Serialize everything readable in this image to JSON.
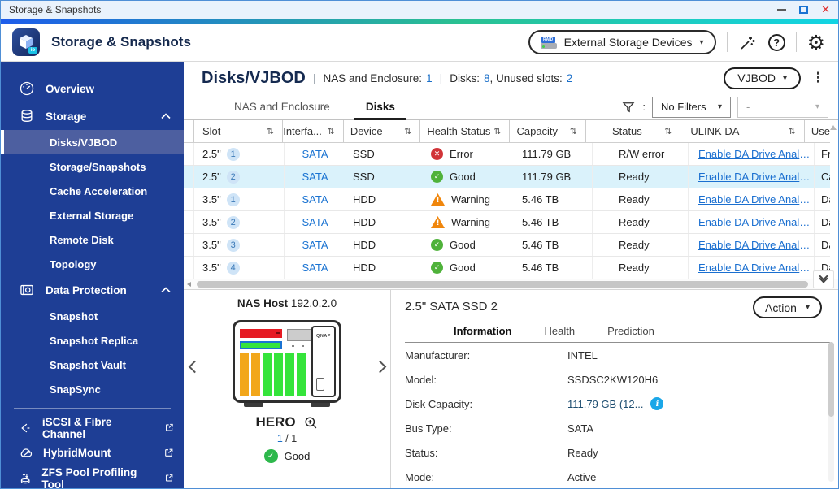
{
  "window": {
    "title": "Storage & Snapshots"
  },
  "app_header": {
    "title": "Storage & Snapshots",
    "logo_badge": "io",
    "external_storage_button": "External Storage Devices"
  },
  "sidebar": {
    "overview": {
      "label": "Overview"
    },
    "storage": {
      "label": "Storage",
      "children": [
        {
          "label": "Disks/VJBOD",
          "selected": true
        },
        {
          "label": "Storage/Snapshots",
          "selected": false
        },
        {
          "label": "Cache Acceleration",
          "selected": false
        },
        {
          "label": "External Storage",
          "selected": false
        },
        {
          "label": "Remote Disk",
          "selected": false
        },
        {
          "label": "Topology",
          "selected": false
        }
      ]
    },
    "data_protection": {
      "label": "Data Protection",
      "children": [
        {
          "label": "Snapshot"
        },
        {
          "label": "Snapshot Replica"
        },
        {
          "label": "Snapshot Vault"
        },
        {
          "label": "SnapSync"
        }
      ]
    },
    "links": [
      {
        "label": "iSCSI & Fibre Channel"
      },
      {
        "label": "HybridMount"
      },
      {
        "label": "ZFS Pool Profiling Tool"
      }
    ]
  },
  "page": {
    "title": "Disks/VJBOD",
    "summary": {
      "p1": "NAS and Enclosure:",
      "v1": "1",
      "p2": "Disks:",
      "v2": "8",
      "p3": ", Unused slots:",
      "v3": "2"
    },
    "vjbod_button": "VJBOD"
  },
  "tabs": [
    {
      "label": "NAS and Enclosure",
      "active": false
    },
    {
      "label": "Disks",
      "active": true
    }
  ],
  "filters": {
    "primary": "No Filters",
    "secondary": "-"
  },
  "table": {
    "columns": [
      "Slot",
      "Interfa...",
      "Device",
      "Health Status",
      "Capacity",
      "Status",
      "ULINK DA",
      "Use"
    ],
    "rows": [
      {
        "slot": "2.5\"",
        "slot_num": "1",
        "interface": "SATA",
        "device": "SSD",
        "health": "Error",
        "health_type": "error",
        "capacity": "111.79 GB",
        "status": "R/W error",
        "ulink": "Enable DA Drive Analy...",
        "use": "Free",
        "selected": false
      },
      {
        "slot": "2.5\"",
        "slot_num": "2",
        "interface": "SATA",
        "device": "SSD",
        "health": "Good",
        "health_type": "good",
        "capacity": "111.79 GB",
        "status": "Ready",
        "ulink": "Enable DA Drive Analy...",
        "use": "Cache",
        "selected": true
      },
      {
        "slot": "3.5\"",
        "slot_num": "1",
        "interface": "SATA",
        "device": "HDD",
        "health": "Warning",
        "health_type": "warning",
        "capacity": "5.46 TB",
        "status": "Ready",
        "ulink": "Enable DA Drive Analy...",
        "use": "Data",
        "selected": false
      },
      {
        "slot": "3.5\"",
        "slot_num": "2",
        "interface": "SATA",
        "device": "HDD",
        "health": "Warning",
        "health_type": "warning",
        "capacity": "5.46 TB",
        "status": "Ready",
        "ulink": "Enable DA Drive Analy...",
        "use": "Data",
        "selected": false
      },
      {
        "slot": "3.5\"",
        "slot_num": "3",
        "interface": "SATA",
        "device": "HDD",
        "health": "Good",
        "health_type": "good",
        "capacity": "5.46 TB",
        "status": "Ready",
        "ulink": "Enable DA Drive Analy...",
        "use": "Data",
        "selected": false
      },
      {
        "slot": "3.5\"",
        "slot_num": "4",
        "interface": "SATA",
        "device": "HDD",
        "health": "Good",
        "health_type": "good",
        "capacity": "5.46 TB",
        "status": "Ready",
        "ulink": "Enable DA Drive Analy...",
        "use": "Data",
        "selected": false
      }
    ]
  },
  "nas_panel": {
    "host_label": "NAS Host",
    "host_ip": "192.0.2.0",
    "brand": "QNAP",
    "name": "HERO",
    "page_current": "1",
    "page_rest": "/ 1",
    "status": "Good"
  },
  "details": {
    "title": "2.5\" SATA SSD 2",
    "action_button": "Action",
    "tabs": [
      {
        "label": "Information",
        "active": true
      },
      {
        "label": "Health",
        "active": false
      },
      {
        "label": "Prediction",
        "active": false
      }
    ],
    "fields": [
      {
        "label": "Manufacturer:",
        "value": "INTEL"
      },
      {
        "label": "Model:",
        "value": "SSDSC2KW120H6"
      },
      {
        "label": "Disk Capacity:",
        "value": "111.79 GB (12...",
        "info": true
      },
      {
        "label": "Bus Type:",
        "value": "SATA"
      },
      {
        "label": "Status:",
        "value": "Ready"
      },
      {
        "label": "Mode:",
        "value": "Active"
      }
    ]
  },
  "colors": {
    "sidebar_blue": "#1e3e95",
    "sidebar_selected": "#4d5fa0",
    "gradient_left": "#1d5ceb",
    "gradient_mid": "#2ac191",
    "gradient_right": "#12d4e4",
    "link_blue": "#1a73d2",
    "number_blue": "#1a6fc9",
    "title_navy": "#152a50",
    "error_red": "#d13438",
    "good_green": "#4fb23a",
    "warning_orange": "#f0860c",
    "selected_row": "#daf2fb",
    "info_blue": "#1ba7e8"
  },
  "icons": [
    "minimize-icon",
    "maximize-icon",
    "close-icon",
    "external-drive-icon",
    "wand-icon",
    "help-icon",
    "gear-icon",
    "gauge-icon",
    "database-icon",
    "snapshot-icon",
    "iscsi-icon",
    "cloud-icon",
    "zfs-icon",
    "external-link-icon",
    "funnel-icon",
    "sort-icon",
    "kebab-icon",
    "caret-down-icon",
    "error-icon",
    "good-icon",
    "warning-icon",
    "info-icon",
    "magnifier-plus-icon",
    "chevron-left-icon",
    "chevron-right-icon",
    "double-chevron-down-icon"
  ]
}
